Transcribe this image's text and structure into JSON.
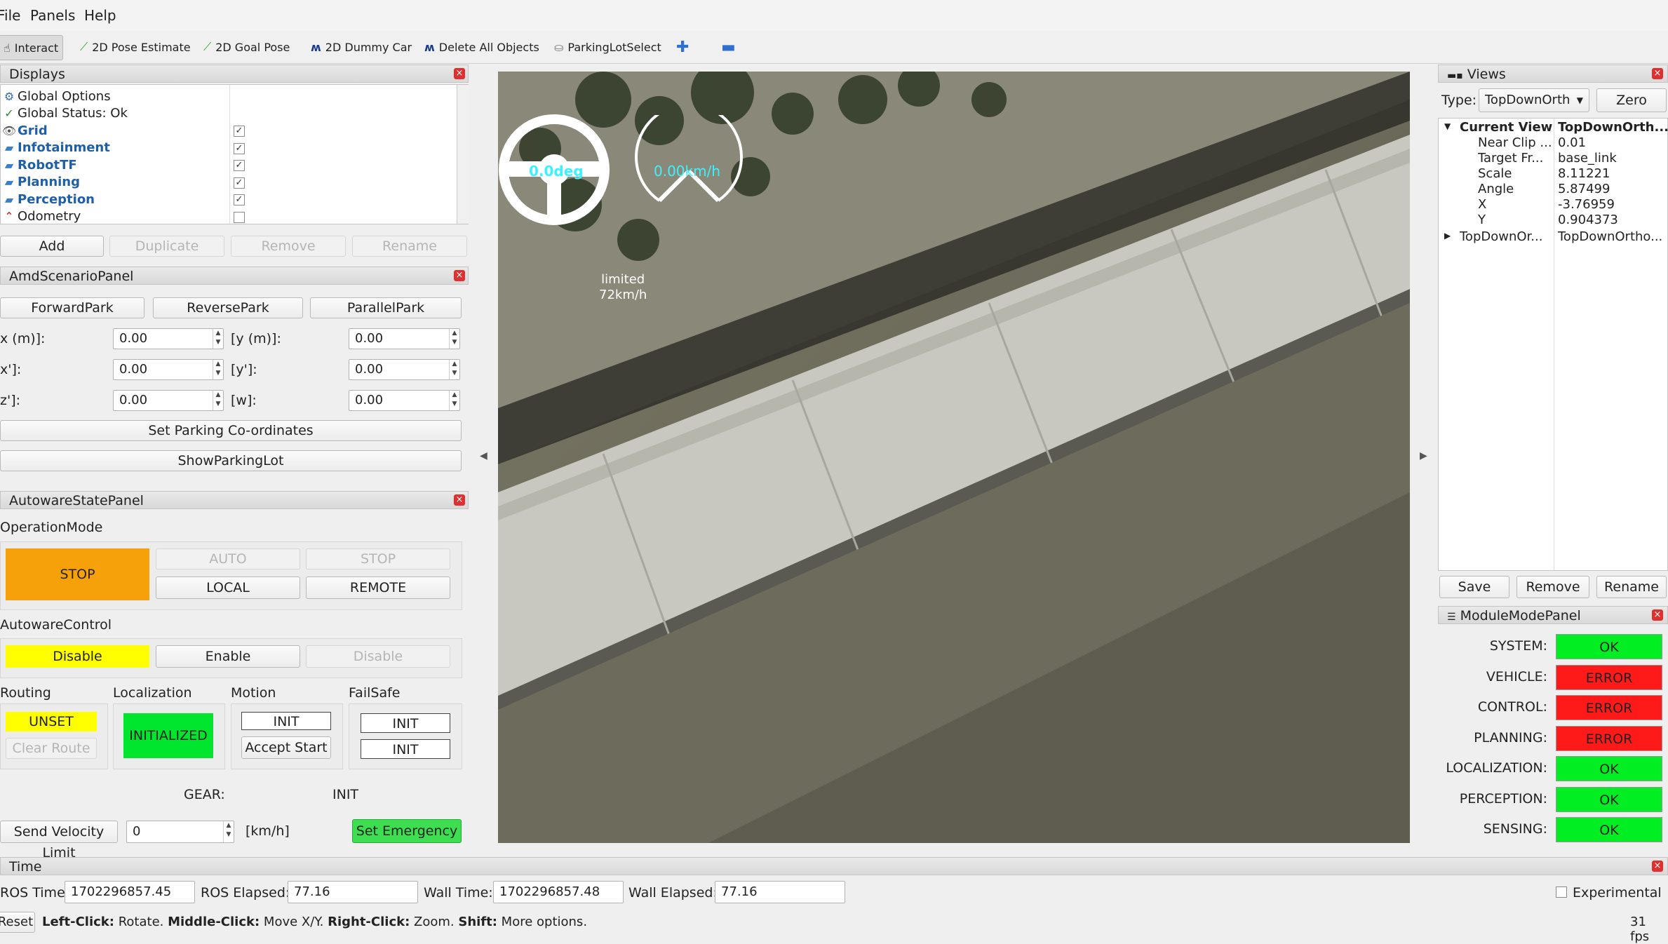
{
  "menu": [
    "File",
    "Panels",
    "Help"
  ],
  "toolbar": {
    "interact": "Interact",
    "pose_estimate": "2D Pose Estimate",
    "goal_pose": "2D Goal Pose",
    "dummy_car": "2D Dummy Car",
    "delete_all": "Delete All Objects",
    "parking_lot_select": "ParkingLotSelect"
  },
  "displays": {
    "title": "Displays",
    "items": [
      {
        "label": "Global Options",
        "icon": "gear-icon",
        "checked": null
      },
      {
        "label": "Global Status: Ok",
        "icon": "check-icon",
        "checked": null
      },
      {
        "label": "Grid",
        "icon": "grid-icon",
        "checked": true
      },
      {
        "label": "Infotainment",
        "icon": "folder-icon",
        "checked": true
      },
      {
        "label": "RobotTF",
        "icon": "folder-icon",
        "checked": true
      },
      {
        "label": "Planning",
        "icon": "folder-icon",
        "checked": true
      },
      {
        "label": "Perception",
        "icon": "folder-icon",
        "checked": true
      },
      {
        "label": "Odometry",
        "icon": "odometry-icon",
        "checked": false
      }
    ],
    "buttons": {
      "add": "Add",
      "duplicate": "Duplicate",
      "remove": "Remove",
      "rename": "Rename"
    }
  },
  "scenario": {
    "title": "AmdScenarioPanel",
    "forward": "ForwardPark",
    "reverse": "ReversePark",
    "parallel": "ParallelPark",
    "x_label": "x (m)]:",
    "x_val": "0.00",
    "y_label": "[y (m)]:",
    "y_val": "0.00",
    "xp_label": "x']:",
    "xp_val": "0.00",
    "yp_label": "[y']:",
    "yp_val": "0.00",
    "zp_label": "z']:",
    "zp_val": "0.00",
    "w_label": "[w]:",
    "w_val": "0.00",
    "set_coords": "Set Parking Co-ordinates",
    "show_lot": "ShowParkingLot"
  },
  "autoware": {
    "title": "AutowareStatePanel",
    "operation_mode": "OperationMode",
    "stop_status": "STOP",
    "auto": "AUTO",
    "stop_btn": "STOP",
    "local": "LOCAL",
    "remote": "REMOTE",
    "control_label": "AutowareControl",
    "disable_status": "Disable",
    "enable": "Enable",
    "disable_btn": "Disable",
    "routing": "Routing",
    "localization": "Localization",
    "motion": "Motion",
    "failsafe": "FailSafe",
    "unset": "UNSET",
    "clear_route": "Clear Route",
    "initialized": "INITIALIZED",
    "motion_init": "INIT",
    "accept_start": "Accept Start",
    "failsafe_init1": "INIT",
    "failsafe_init2": "INIT",
    "gear_label": "GEAR:",
    "gear_val": "INIT",
    "send_velocity": "Send Velocity Limit",
    "velocity_val": "0",
    "unit": "[km/h]",
    "set_emergency": "Set Emergency",
    "colors": {
      "stop": "#f7a10a",
      "disable": "#ffff00",
      "unset": "#ffff00",
      "initialized": "#00e62e",
      "emergency": "#3ddf51"
    }
  },
  "viewport": {
    "steering": "0.0deg",
    "speed": "0.00km/h",
    "limit_line1": "limited",
    "limit_line2": "72km/h"
  },
  "views": {
    "title": "Views",
    "type_label": "Type:",
    "type_val": "TopDownOrth",
    "zero": "Zero",
    "current_view": "Current View",
    "current_view_val": "TopDownOrth...",
    "props": [
      {
        "k": "Near Clip ...",
        "v": "0.01"
      },
      {
        "k": "Target Fr...",
        "v": "base_link"
      },
      {
        "k": "Scale",
        "v": "8.11221"
      },
      {
        "k": "Angle",
        "v": "5.87499"
      },
      {
        "k": "X",
        "v": "-3.76959"
      },
      {
        "k": "Y",
        "v": "0.904373"
      }
    ],
    "saved_k": "TopDownOr...",
    "saved_v": "TopDownOrtho...",
    "save": "Save",
    "remove": "Remove",
    "rename": "Rename"
  },
  "modules": {
    "title": "ModuleModePanel",
    "rows": [
      {
        "name": "SYSTEM:",
        "val": "OK",
        "ok": true
      },
      {
        "name": "VEHICLE:",
        "val": "ERROR",
        "ok": false
      },
      {
        "name": "CONTROL:",
        "val": "ERROR",
        "ok": false
      },
      {
        "name": "PLANNING:",
        "val": "ERROR",
        "ok": false
      },
      {
        "name": "LOCALIZATION:",
        "val": "OK",
        "ok": true
      },
      {
        "name": "PERCEPTION:",
        "val": "OK",
        "ok": true
      },
      {
        "name": "SENSING:",
        "val": "OK",
        "ok": true
      }
    ],
    "colors": {
      "ok": "#00ee22",
      "error": "#ff1a1a"
    }
  },
  "time": {
    "title": "Time",
    "ros_time_label": "ROS Time:",
    "ros_time": "1702296857.45",
    "ros_elapsed_label": "ROS Elapsed:",
    "ros_elapsed": "77.16",
    "wall_time_label": "Wall Time:",
    "wall_time": "1702296857.48",
    "wall_elapsed_label": "Wall Elapsed:",
    "wall_elapsed": "77.16",
    "experimental": "Experimental"
  },
  "statusbar": {
    "reset": "Reset",
    "h1": "Left-Click:",
    "t1": " Rotate. ",
    "h2": "Middle-Click:",
    "t2": " Move X/Y. ",
    "h3": "Right-Click:",
    "t3": " Zoom. ",
    "h4": "Shift:",
    "t4": " More options.",
    "fps": "31 fps"
  }
}
